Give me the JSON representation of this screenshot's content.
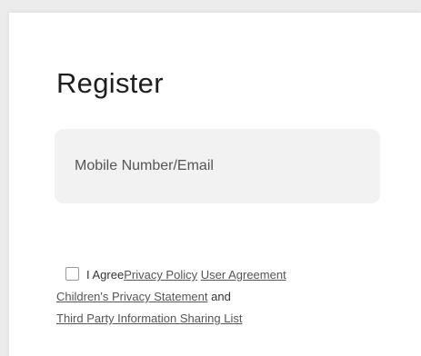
{
  "form": {
    "title": "Register",
    "input_placeholder": "Mobile Number/Email"
  },
  "agreement": {
    "checked": false,
    "prefix": "I Agree",
    "privacy_policy": "Privacy Policy",
    "user_agreement": "User Agreement",
    "children_privacy": "Children's Privacy Statement",
    "and_text": " and ",
    "third_party": "Third Party Information Sharing List"
  },
  "colors": {
    "background": "#ececec",
    "card": "#ffffff",
    "input_bg": "#f2f2f2",
    "text": "#1e1e1e"
  }
}
